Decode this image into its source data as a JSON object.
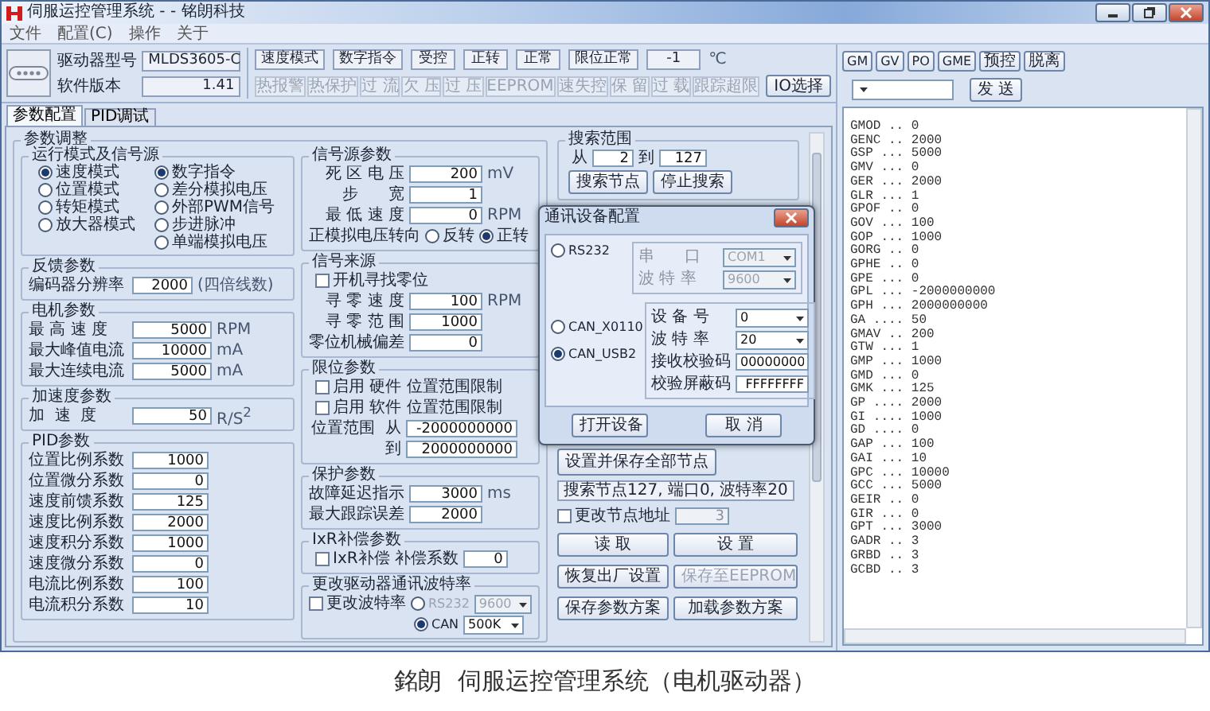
{
  "window": {
    "title": "伺服运控管理系统 - - 铭朗科技"
  },
  "menu": [
    "文件",
    "配置(C)",
    "操作",
    "关于"
  ],
  "toolbar": {
    "model_label": "驱动器型号",
    "model": "MLDS3605-C",
    "version_label": "软件版本",
    "version": "1.41",
    "status": [
      "速度模式",
      "数字指令",
      "受控",
      "正转",
      "正常",
      "限位正常",
      "-1"
    ],
    "temp_unit": "℃",
    "alarms": [
      {
        "label": "热报警",
        "active": false
      },
      {
        "label": "热保护",
        "active": false
      },
      {
        "label": "过 流",
        "active": false
      },
      {
        "label": "欠 压",
        "active": false
      },
      {
        "label": "过 压",
        "active": false
      },
      {
        "label": "EEPROM",
        "active": false
      },
      {
        "label": "速失控",
        "active": false
      },
      {
        "label": "保 留",
        "active": false
      },
      {
        "label": "过 载",
        "active": false
      },
      {
        "label": "跟踪超限",
        "active": false
      }
    ],
    "io_button": "IO选择"
  },
  "tabs": [
    {
      "label": "参数配置",
      "selected": true
    },
    {
      "label": "PID调试",
      "selected": false
    }
  ],
  "params": {
    "title": "参数调整",
    "mode": {
      "title": "运行模式及信号源",
      "modes": [
        {
          "label": "速度模式",
          "selected": true
        },
        {
          "label": "位置模式",
          "selected": false
        },
        {
          "label": "转矩模式",
          "selected": false
        },
        {
          "label": "放大器模式",
          "selected": false
        }
      ],
      "sources": [
        {
          "label": "数字指令",
          "selected": true
        },
        {
          "label": "差分模拟电压",
          "selected": false
        },
        {
          "label": "外部PWM信号",
          "selected": false
        },
        {
          "label": "步进脉冲",
          "selected": false
        },
        {
          "label": "单端模拟电压",
          "selected": false
        }
      ]
    },
    "feedback": {
      "title": "反馈参数",
      "rows": [
        {
          "label": "编码器分辨率",
          "value": "2000",
          "unit": "(四倍线数)"
        }
      ]
    },
    "motor": {
      "title": "电机参数",
      "rows": [
        {
          "label": "最 高 速 度",
          "value": "5000",
          "unit": "RPM"
        },
        {
          "label": "最大峰值电流",
          "value": "10000",
          "unit": "mA"
        },
        {
          "label": "最大连续电流",
          "value": "5000",
          "unit": "mA"
        }
      ]
    },
    "accel": {
      "title": "加速度参数",
      "rows": [
        {
          "label": "加  速  度",
          "value": "50",
          "unit": "R/S$^{2}$"
        }
      ]
    },
    "pid": {
      "title": "PID参数",
      "rows": [
        {
          "label": "位置比例系数",
          "value": "1000"
        },
        {
          "label": "位置微分系数",
          "value": "0"
        },
        {
          "label": "速度前馈系数",
          "value": "125"
        },
        {
          "label": "速度比例系数",
          "value": "2000"
        },
        {
          "label": "速度积分系数",
          "value": "1000"
        },
        {
          "label": "速度微分系数",
          "value": "0"
        },
        {
          "label": "电流比例系数",
          "value": "100"
        },
        {
          "label": "电流积分系数",
          "value": "10"
        }
      ]
    },
    "signal": {
      "title": "信号源参数",
      "rows": [
        {
          "label": "死 区 电 压",
          "value": "200",
          "unit": "mV"
        },
        {
          "label": "步      宽",
          "value": "1"
        },
        {
          "label": "最 低 速 度",
          "value": "0",
          "unit": "RPM"
        }
      ],
      "direction": {
        "label": "正模拟电压转向",
        "options": [
          {
            "label": "反转",
            "selected": false
          },
          {
            "label": "正转",
            "selected": true
          }
        ]
      }
    },
    "homing": {
      "title": "信号来源",
      "check": {
        "label": "开机寻找零位",
        "checked": false
      },
      "rows": [
        {
          "label": "寻 零 速 度",
          "value": "100",
          "unit": "RPM"
        },
        {
          "label": "寻 零 范 围",
          "value": "1000"
        },
        {
          "label": "零位机械偏差",
          "value": "0"
        }
      ]
    },
    "limits": {
      "title": "限位参数",
      "checks": [
        {
          "label": "启用 硬件 位置范围限制",
          "checked": false
        },
        {
          "label": "启用 软件 位置范围限制",
          "checked": false
        }
      ],
      "range": [
        {
          "label": "位置范围  从",
          "value": "-2000000000"
        },
        {
          "label": "到",
          "value": "2000000000"
        }
      ]
    },
    "protection": {
      "title": "保护参数",
      "rows": [
        {
          "label": "故障延迟指示",
          "value": "3000",
          "unit": "ms"
        },
        {
          "label": "最大跟踪误差",
          "value": "2000"
        }
      ]
    },
    "ixr": {
      "title": "IxR补偿参数",
      "check": {
        "label": "IxR补偿",
        "checked": false
      },
      "coef_label": "补偿系数",
      "coef": "0"
    },
    "baud": {
      "title": "更改驱动器通讯波特率",
      "check": {
        "label": "更改波特率",
        "checked": false
      },
      "options": [
        {
          "label": "RS232",
          "selected": false,
          "disabled": true,
          "value": "9600"
        },
        {
          "label": "CAN",
          "selected": true,
          "disabled": false,
          "value": "500K"
        }
      ]
    }
  },
  "search": {
    "title": "搜索范围",
    "from_label": "从",
    "from": "2",
    "to_label": "到",
    "to": "127",
    "buttons": [
      "搜索节点",
      "停止搜索"
    ]
  },
  "nodes": {
    "save_all": "设置并保存全部节点",
    "status": "搜索节点127, 端口0, 波特率20",
    "change_addr": {
      "label": "更改节点地址",
      "checked": false,
      "value": "3",
      "disabled": true
    },
    "buttons": [
      {
        "label": "读 取",
        "disabled": false
      },
      {
        "label": "设 置",
        "disabled": false
      },
      {
        "label": "恢复出厂设置",
        "disabled": false
      },
      {
        "label": "保存至EEPROM",
        "disabled": true
      },
      {
        "label": "保存参数方案",
        "disabled": false
      },
      {
        "label": "加载参数方案",
        "disabled": false
      }
    ]
  },
  "dialog": {
    "title": "通讯设备配置",
    "options": [
      {
        "label": "RS232",
        "selected": false
      },
      {
        "label": "CAN_X0110",
        "selected": false
      },
      {
        "label": "CAN_USB2",
        "selected": true
      }
    ],
    "rs232_fields": [
      {
        "label": "串      口",
        "value": "COM1",
        "disabled": true
      },
      {
        "label": "波 特 率",
        "value": "9600",
        "disabled": true
      }
    ],
    "can_fields": [
      {
        "label": "设 备 号",
        "value": "0",
        "kind": "select"
      },
      {
        "label": "波 特 率",
        "value": "20",
        "kind": "select"
      },
      {
        "label": "接收校验码",
        "value": "00000000",
        "kind": "text"
      },
      {
        "label": "校验屏蔽码",
        "value": "FFFFFFFF",
        "kind": "text"
      }
    ],
    "buttons": [
      "打开设备",
      "取 消"
    ]
  },
  "console": {
    "quick_buttons": [
      "GM",
      "GV",
      "PO",
      "GME",
      "预控",
      "脱离"
    ],
    "send": "发 送",
    "lines": [
      "GMOD .. 0",
      "GENC .. 2000",
      "GSP ... 5000",
      "GMV ... 0",
      "GER ... 2000",
      "GLR ... 1",
      "GPOF .. 0",
      "GOV ... 100",
      "GOP ... 1000",
      "GORG .. 0",
      "GPHE .. 0",
      "GPE ... 0",
      "GPL ... -2000000000",
      "GPH ... 2000000000",
      "GA .... 50",
      "GMAV .. 200",
      "GTW ... 1",
      "GMP ... 1000",
      "GMD ... 0",
      "GMK ... 125",
      "GP .... 2000",
      "GI .... 1000",
      "GD .... 0",
      "GAP ... 100",
      "GAI ... 10",
      "GPC ... 10000",
      "GCC ... 5000",
      "GEIR .. 0",
      "GIR ... 0",
      "GPT ... 3000",
      "GADR .. 3",
      "GRBD .. 3",
      "GCBD .. 3"
    ]
  },
  "caption": "銘朗  伺服运控管理系统（电机驱动器）"
}
